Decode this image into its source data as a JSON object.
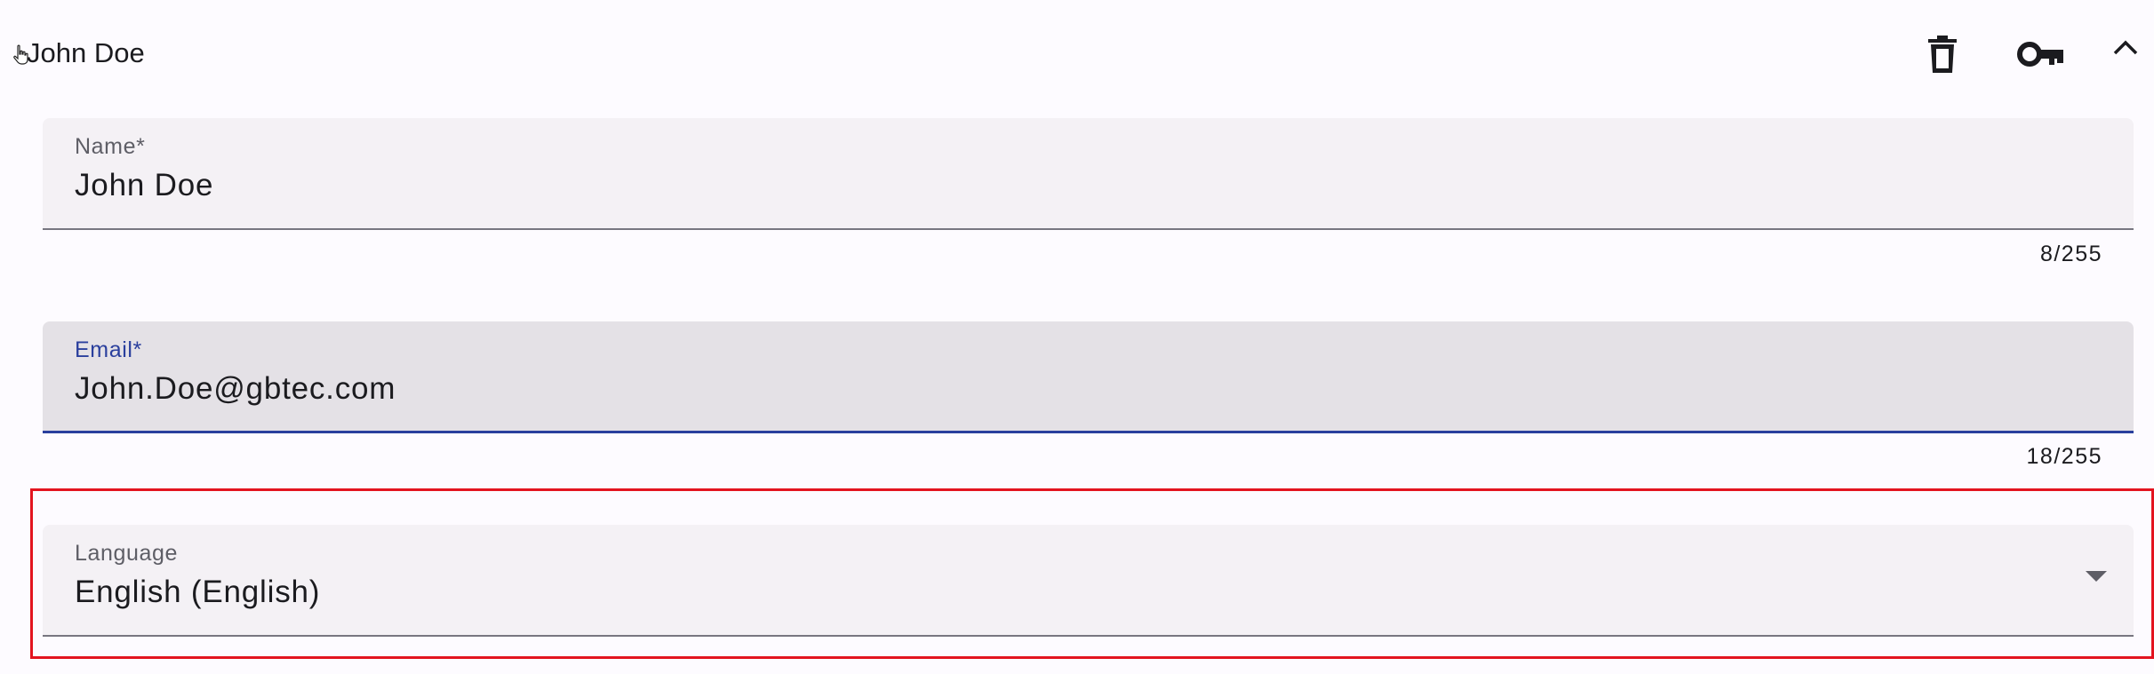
{
  "header": {
    "title": "John Doe",
    "icons": {
      "cursor": "hand-pointer-icon",
      "delete": "trash-icon",
      "key": "key-icon",
      "collapse": "chevron-up-icon"
    }
  },
  "name": {
    "label": "Name*",
    "value": "John Doe",
    "counter": "8/255"
  },
  "email": {
    "label": "Email*",
    "value": "John.Doe@gbtec.com",
    "counter": "18/255"
  },
  "language": {
    "label": "Language",
    "value": "English (English)"
  },
  "colors": {
    "accent": "#2a3f9d",
    "highlight": "#e3141f",
    "field_bg": "#f4f1f5",
    "field_focused_bg": "#e4e1e6",
    "page_bg": "#fdfbff"
  }
}
